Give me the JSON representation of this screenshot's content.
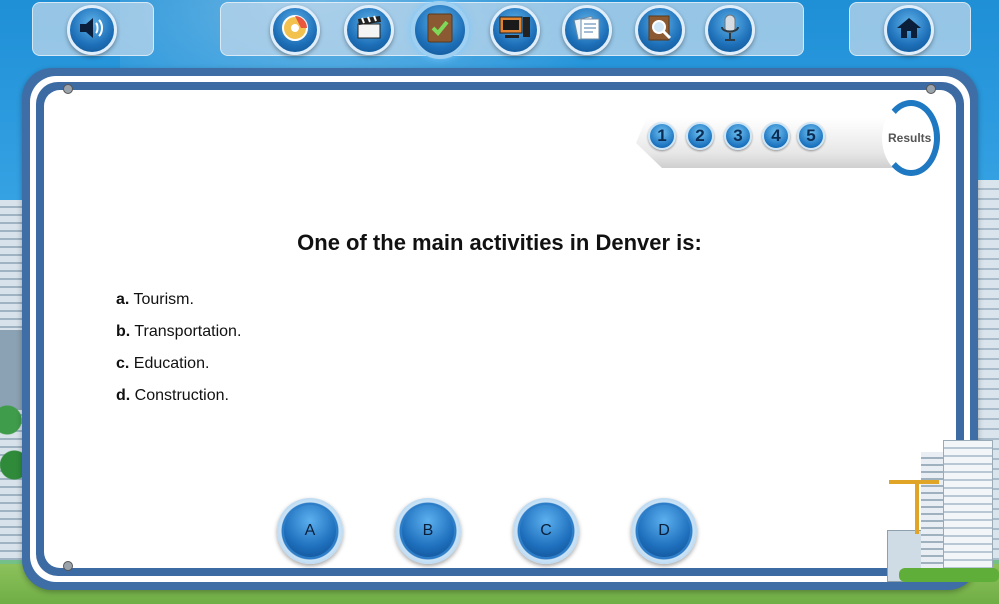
{
  "toolbar": {
    "left_buttons": [
      {
        "name": "speaker-button",
        "icon": "speaker-icon"
      }
    ],
    "center_buttons": [
      {
        "name": "cd-button",
        "icon": "cd-icon"
      },
      {
        "name": "clapperboard-button",
        "icon": "clapperboard-icon"
      },
      {
        "name": "book-check-button",
        "icon": "book-check-icon",
        "active": true
      },
      {
        "name": "computer-button",
        "icon": "computer-icon"
      },
      {
        "name": "documents-button",
        "icon": "documents-icon"
      },
      {
        "name": "search-book-button",
        "icon": "search-book-icon"
      },
      {
        "name": "microphone-button",
        "icon": "microphone-icon"
      }
    ],
    "right_buttons": [
      {
        "name": "home-button",
        "icon": "home-icon"
      }
    ]
  },
  "progress": {
    "steps": [
      "1",
      "2",
      "3",
      "4",
      "5"
    ],
    "results_label": "Results"
  },
  "question": {
    "text": "One of the main activities in Denver is:",
    "options": [
      {
        "letter": "a.",
        "text": "Tourism."
      },
      {
        "letter": "b.",
        "text": "Transportation."
      },
      {
        "letter": "c.",
        "text": "Education."
      },
      {
        "letter": "d.",
        "text": "Construction."
      }
    ]
  },
  "answers": {
    "buttons": [
      "A",
      "B",
      "C",
      "D"
    ]
  },
  "colors": {
    "board_frame": "#3f6ea7",
    "button_blue": "#1e6fbd",
    "sky": "#2f9de0"
  }
}
